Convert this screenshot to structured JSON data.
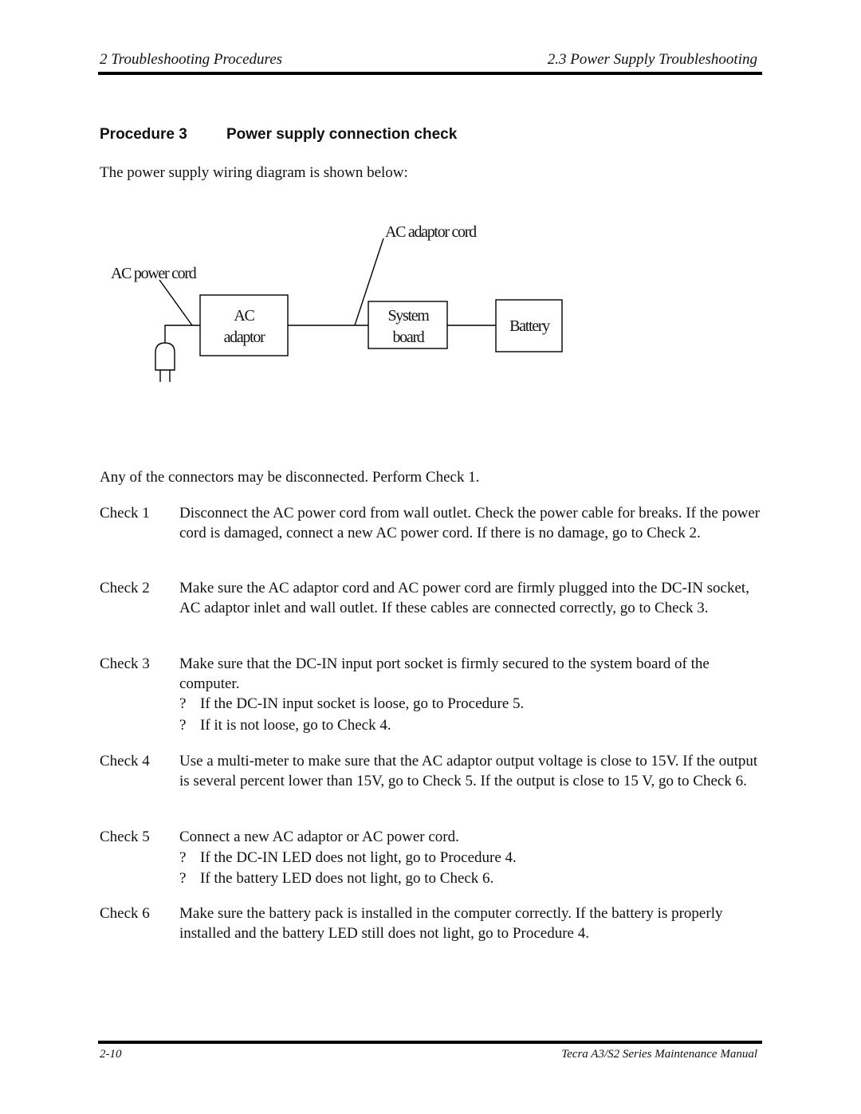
{
  "header": {
    "left": "2  Troubleshooting Procedures",
    "right": "2.3  Power Supply Troubleshooting"
  },
  "procedure": {
    "number": "Procedure 3",
    "title": "Power supply connection check"
  },
  "intro": "The power supply wiring diagram is shown below:",
  "diagram": {
    "labels": {
      "ac_power_cord": "AC power cord",
      "ac_adaptor_cord": "AC adaptor cord"
    },
    "blocks": {
      "ac_adaptor": [
        "AC",
        "adaptor"
      ],
      "system_board": [
        "System",
        "board"
      ],
      "battery": "Battery"
    },
    "icons": {
      "plug": "power-plug-icon"
    }
  },
  "connectors_note": "Any of the connectors may be disconnected.  Perform Check 1.",
  "checks": [
    {
      "label": "Check 1",
      "text": "Disconnect the AC power cord from wall outlet. Check the power cable for breaks. If the power cord is damaged, connect a new AC power cord. If there is no damage, go to Check 2.",
      "bullets": []
    },
    {
      "label": "Check 2",
      "text": "Make sure the AC adaptor cord and AC power cord are firmly plugged into the DC-IN socket, AC adaptor inlet and wall outlet. If these cables are connected correctly, go to Check 3.",
      "bullets": []
    },
    {
      "label": "Check 3",
      "text": "Make sure that the DC-IN input port socket is firmly secured to the system board of the computer.",
      "bullets": [
        "If the DC-IN input socket is loose, go to Procedure 5.",
        "If it is not loose, go to Check 4."
      ]
    },
    {
      "label": "Check 4",
      "text": "Use a multi-meter to make sure that the AC adaptor output voltage is close to 15V.  If the output is several percent lower than 15V, go to Check 5.  If the output is close to 15 V, go to Check 6.",
      "bullets": []
    },
    {
      "label": "Check 5",
      "text": "Connect a new AC adaptor or AC power cord.",
      "bullets": [
        "If the DC-IN LED does not light, go to Procedure 4.",
        "If the battery LED does not light, go to Check 6."
      ]
    },
    {
      "label": "Check 6",
      "text": "Make sure the battery pack is installed in the computer correctly.  If the battery is properly installed and the battery LED still does not light, go to Procedure 4.",
      "bullets": []
    }
  ],
  "bullet_mark": "?",
  "footer": {
    "page": "2-10",
    "manual": "Tecra A3/S2 Series Maintenance Manual"
  }
}
